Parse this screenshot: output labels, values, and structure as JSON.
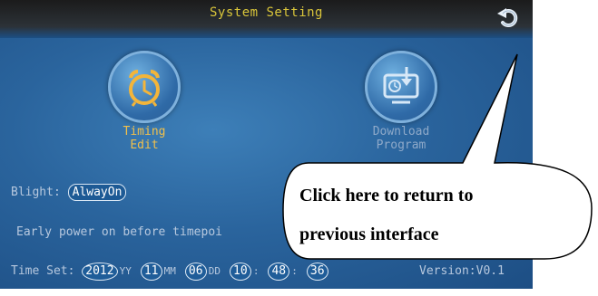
{
  "screen": {
    "title": "System Setting",
    "icons": [
      {
        "label_line1": "Timing",
        "label_line2": "Edit"
      },
      {
        "label_line1": "Download",
        "label_line2": "Program"
      }
    ],
    "blight": {
      "label": "Blight:",
      "value": "AlwayOn"
    },
    "early_power": {
      "text": "Early power on before timepoi"
    },
    "time_set": {
      "label": "Time Set:",
      "year": "2012",
      "year_unit": "YY",
      "month": "11",
      "month_unit": "MM",
      "day": "06",
      "day_unit": "DD",
      "hour": "10",
      "sep1": ":",
      "minute": "48",
      "sep2": ":",
      "second": "36"
    },
    "version": "Version:V0.1"
  },
  "callout": {
    "line1": "Click here to return to",
    "line2": "previous interface"
  },
  "colors": {
    "screen_bg": "#2a649d",
    "title_text": "#d9c53a",
    "timing_label": "#f1c04b",
    "download_label": "#8ea9c9"
  }
}
